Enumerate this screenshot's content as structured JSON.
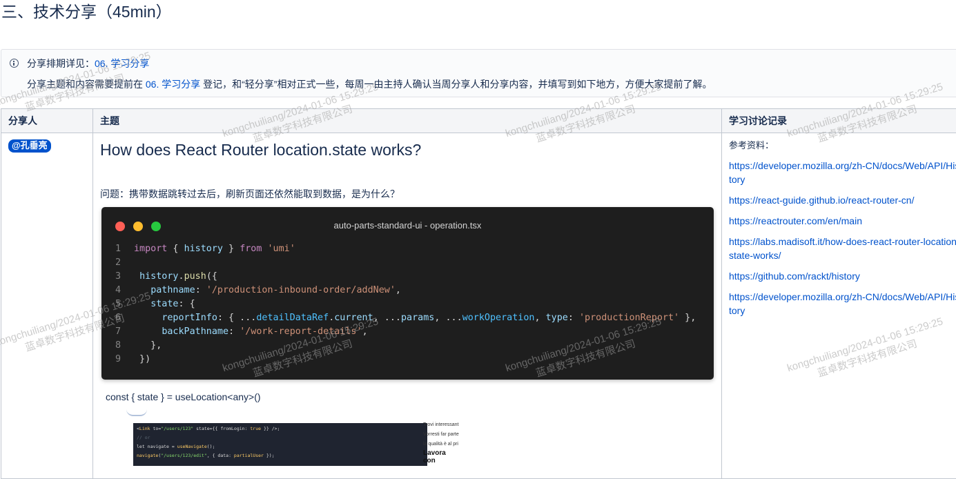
{
  "section": {
    "title": "三、技术分享（45min）"
  },
  "info": {
    "line1_prefix": "分享排期详见：",
    "line1_link": "06. 学习分享",
    "line2_prefix": "分享主题和内容需要提前在",
    "line2_link": "06. 学习分享",
    "line2_suffix": "登记，和“轻分享”相对正式一些，每周一由主持人确认当周分享人和分享内容，并填写到如下地方，方便大家提前了解。"
  },
  "table": {
    "headers": [
      "分享人",
      "主题",
      "学习讨论记录"
    ],
    "row": {
      "sharer": "@孔垂亮",
      "topic_title": "How does React Router location.state works?",
      "question": "问题：携带数据跳转过去后，刷新页面还依然能取到数据，是为什么？",
      "code_window_title": "auto-parts-standard-ui - operation.tsx",
      "const_line": "const { state } = useLocation<any>()",
      "notes_label": "参考资料：",
      "links": [
        "https://developer.mozilla.org/zh-CN/docs/Web/API/History",
        "https://react-guide.github.io/react-router-cn/",
        "https://reactrouter.com/en/main",
        "https://labs.madisoft.it/how-does-react-router-location-state-works/",
        "https://github.com/rackt/history",
        "https://developer.mozilla.org/zh-CN/docs/Web/API/History"
      ]
    }
  },
  "embedded_screenshot": {
    "text_lines": [
      "Trovi interessant",
      "Vorresti far parte",
      "la qualità è al pri"
    ],
    "bold": "Lavora con"
  },
  "watermark": {
    "user_line": "kongchuiliang/2024-01-06 15:29:25",
    "company_line": "蓝卓数字科技有限公司"
  }
}
